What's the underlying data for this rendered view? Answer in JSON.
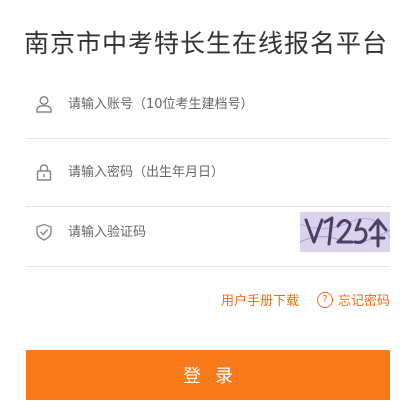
{
  "page": {
    "title": "南京市中考特长生在线报名平台"
  },
  "form": {
    "account_placeholder": "请输入账号（10位考生建档号）",
    "password_placeholder": "请输入密码（出生年月日）",
    "captcha_placeholder": "请输入验证码",
    "captcha_text": "Yk25个"
  },
  "links": {
    "manual": "用户手册下载",
    "forgot": "忘记密码",
    "forgot_icon": "?"
  },
  "actions": {
    "login_label": "登录"
  },
  "colors": {
    "accent": "#fa7a1b",
    "link": "#f26b1d",
    "icon": "#888888",
    "captcha_bg": "#d9d3ec"
  },
  "icons": {
    "account": "user-icon",
    "password": "lock-icon",
    "captcha": "shield-icon",
    "forgot": "question-icon"
  }
}
